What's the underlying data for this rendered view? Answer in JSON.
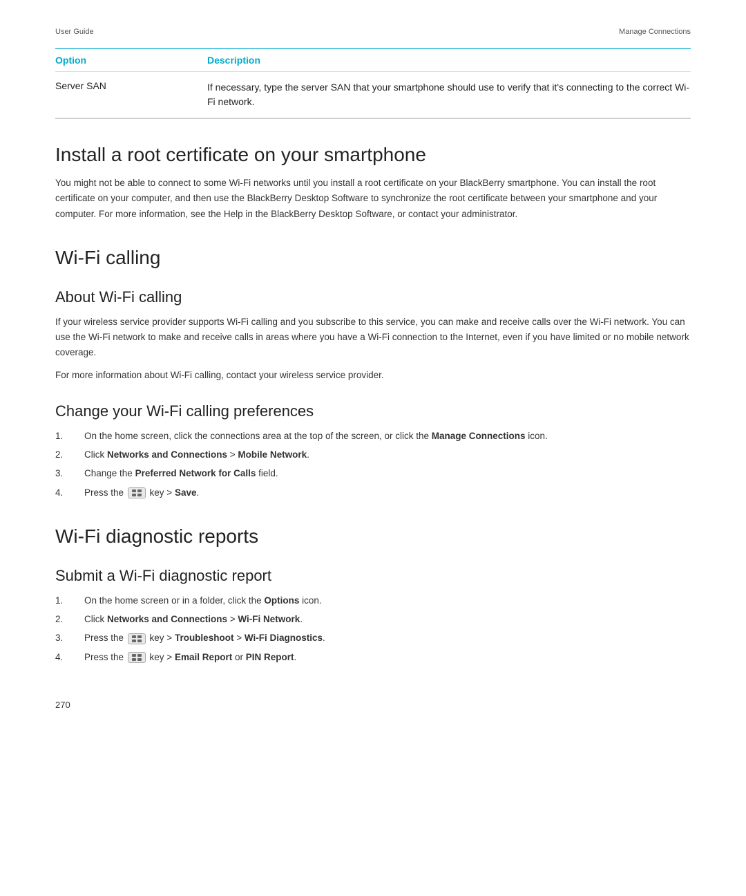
{
  "header": {
    "left": "User Guide",
    "right": "Manage Connections"
  },
  "table": {
    "col_option": "Option",
    "col_description": "Description",
    "rows": [
      {
        "option": "Server SAN",
        "description": "If necessary, type the server SAN that your smartphone should use to verify that it's connecting to the correct Wi-Fi network."
      }
    ]
  },
  "sections": [
    {
      "id": "install-root-cert",
      "heading": "Install a root certificate on your smartphone",
      "paragraphs": [
        "You might not be able to connect to some Wi-Fi networks until you install a root certificate on your BlackBerry smartphone. You can install the root certificate on your computer, and then use the BlackBerry Desktop Software to synchronize the root certificate between your smartphone and your computer. For more information, see the Help in the BlackBerry Desktop Software, or contact your administrator."
      ],
      "subsections": []
    },
    {
      "id": "wifi-calling",
      "heading": "Wi-Fi calling",
      "paragraphs": [],
      "subsections": [
        {
          "id": "about-wifi-calling",
          "subheading": "About Wi-Fi calling",
          "paragraphs": [
            "If your wireless service provider supports Wi-Fi calling and you subscribe to this service, you can make and receive calls over the Wi-Fi network. You can use the Wi-Fi network to make and receive calls in areas where you have a Wi-Fi connection to the Internet, even if you have limited or no mobile network coverage.",
            "For more information about Wi-Fi calling, contact your wireless service provider."
          ],
          "steps": []
        },
        {
          "id": "change-wifi-calling-prefs",
          "subheading": "Change your Wi-Fi calling preferences",
          "paragraphs": [],
          "steps": [
            {
              "num": "1.",
              "parts": [
                {
                  "text": "On the home screen, click the connections area at the top of the screen, or click the "
                },
                {
                  "text": "Manage Connections",
                  "bold": true
                },
                {
                  "text": " icon."
                }
              ]
            },
            {
              "num": "2.",
              "parts": [
                {
                  "text": "Click "
                },
                {
                  "text": "Networks and Connections",
                  "bold": true
                },
                {
                  "text": " > "
                },
                {
                  "text": "Mobile Network",
                  "bold": true
                },
                {
                  "text": "."
                }
              ]
            },
            {
              "num": "3.",
              "parts": [
                {
                  "text": "Change the "
                },
                {
                  "text": "Preferred Network for Calls",
                  "bold": true
                },
                {
                  "text": " field."
                }
              ]
            },
            {
              "num": "4.",
              "parts": [
                {
                  "text": "Press the "
                },
                {
                  "text": "KEY_ICON"
                },
                {
                  "text": " key > "
                },
                {
                  "text": "Save",
                  "bold": true
                },
                {
                  "text": "."
                }
              ]
            }
          ]
        }
      ]
    },
    {
      "id": "wifi-diagnostic-reports",
      "heading": "Wi-Fi diagnostic reports",
      "paragraphs": [],
      "subsections": [
        {
          "id": "submit-wifi-diagnostic-report",
          "subheading": "Submit a Wi-Fi diagnostic report",
          "paragraphs": [],
          "steps": [
            {
              "num": "1.",
              "parts": [
                {
                  "text": "On the home screen or in a folder, click the "
                },
                {
                  "text": "Options",
                  "bold": true
                },
                {
                  "text": " icon."
                }
              ]
            },
            {
              "num": "2.",
              "parts": [
                {
                  "text": "Click "
                },
                {
                  "text": "Networks and Connections",
                  "bold": true
                },
                {
                  "text": " > "
                },
                {
                  "text": "Wi-Fi Network",
                  "bold": true
                },
                {
                  "text": "."
                }
              ]
            },
            {
              "num": "3.",
              "parts": [
                {
                  "text": "Press the "
                },
                {
                  "text": "KEY_ICON"
                },
                {
                  "text": " key > "
                },
                {
                  "text": "Troubleshoot",
                  "bold": true
                },
                {
                  "text": " > "
                },
                {
                  "text": "Wi-Fi Diagnostics",
                  "bold": true
                },
                {
                  "text": "."
                }
              ]
            },
            {
              "num": "4.",
              "parts": [
                {
                  "text": "Press the "
                },
                {
                  "text": "KEY_ICON"
                },
                {
                  "text": " key > "
                },
                {
                  "text": "Email Report",
                  "bold": true
                },
                {
                  "text": " or "
                },
                {
                  "text": "PIN Report",
                  "bold": true
                },
                {
                  "text": "."
                }
              ]
            }
          ]
        }
      ]
    }
  ],
  "footer": {
    "page_number": "270"
  }
}
